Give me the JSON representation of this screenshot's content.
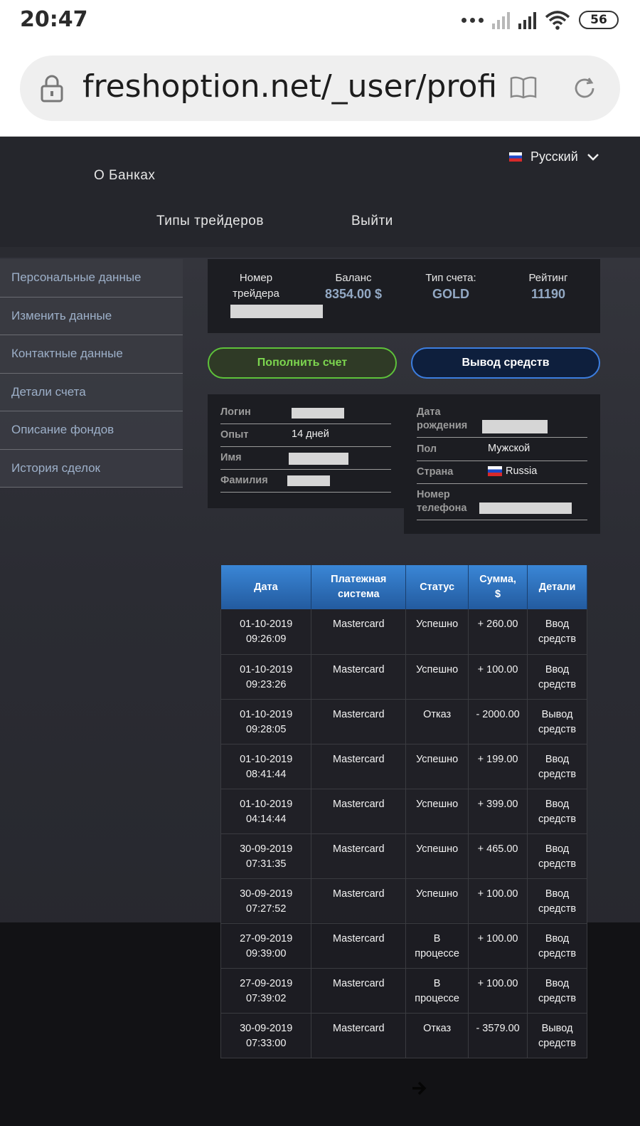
{
  "status_bar": {
    "time": "20:47",
    "battery": "56"
  },
  "browser": {
    "url": "freshoption.net/_user/profile"
  },
  "nav": {
    "about_banks": "О Банках",
    "trader_types": "Типы трейдеров",
    "logout": "Выйти",
    "language": "Русский"
  },
  "sidebar": {
    "items": [
      {
        "label": "Персональные данные"
      },
      {
        "label": "Изменить данные"
      },
      {
        "label": "Контактные данные"
      },
      {
        "label": "Детали счета"
      },
      {
        "label": "Описание фондов"
      },
      {
        "label": "История сделок"
      }
    ]
  },
  "stats": {
    "trader_number_label": "Номер трейдера",
    "balance_label": "Баланс",
    "balance_value": "8354.00 $",
    "account_type_label": "Тип счета:",
    "account_type_value": "GOLD",
    "rating_label": "Рейтинг",
    "rating_value": "11190"
  },
  "buttons": {
    "deposit": "Пополнить счет",
    "withdraw": "Вывод средств"
  },
  "profile_left": {
    "login_label": "Логин",
    "experience_label": "Опыт",
    "experience_value": "14 дней",
    "first_name_label": "Имя",
    "last_name_label": "Фамилия"
  },
  "profile_right": {
    "birth_label": "Дата рождения",
    "gender_label": "Пол",
    "gender_value": "Мужской",
    "country_label": "Страна",
    "country_value": "Russia",
    "phone_label": "Номер телефона"
  },
  "history": {
    "headers": [
      "Дата",
      "Платежная система",
      "Статус",
      "Сумма, $",
      "Детали"
    ],
    "rows": [
      {
        "date": "01-10-2019",
        "time": "09:26:09",
        "system": "Mastercard",
        "status": "Успешно",
        "amount": "+ 260.00",
        "details": "Ввод средств"
      },
      {
        "date": "01-10-2019",
        "time": "09:23:26",
        "system": "Mastercard",
        "status": "Успешно",
        "amount": "+ 100.00",
        "details": "Ввод средств"
      },
      {
        "date": "01-10-2019",
        "time": "09:28:05",
        "system": "Mastercard",
        "status": "Отказ",
        "amount": "- 2000.00",
        "details": "Вывод средств"
      },
      {
        "date": "01-10-2019",
        "time": "08:41:44",
        "system": "Mastercard",
        "status": "Успешно",
        "amount": "+ 199.00",
        "details": "Ввод средств"
      },
      {
        "date": "01-10-2019",
        "time": "04:14:44",
        "system": "Mastercard",
        "status": "Успешно",
        "amount": "+ 399.00",
        "details": "Ввод средств"
      },
      {
        "date": "30-09-2019",
        "time": "07:31:35",
        "system": "Mastercard",
        "status": "Успешно",
        "amount": "+ 465.00",
        "details": "Ввод средств"
      },
      {
        "date": "30-09-2019",
        "time": "07:27:52",
        "system": "Mastercard",
        "status": "Успешно",
        "amount": "+ 100.00",
        "details": "Ввод средств"
      },
      {
        "date": "27-09-2019",
        "time": "09:39:00",
        "system": "Mastercard",
        "status": "В процессе",
        "amount": "+ 100.00",
        "details": "Ввод средств"
      },
      {
        "date": "27-09-2019",
        "time": "07:39:02",
        "system": "Mastercard",
        "status": "В процессе",
        "amount": "+ 100.00",
        "details": "Ввод средств"
      },
      {
        "date": "30-09-2019",
        "time": "07:33:00",
        "system": "Mastercard",
        "status": "Отказ",
        "amount": "- 3579.00",
        "details": "Вывод средств"
      }
    ]
  }
}
